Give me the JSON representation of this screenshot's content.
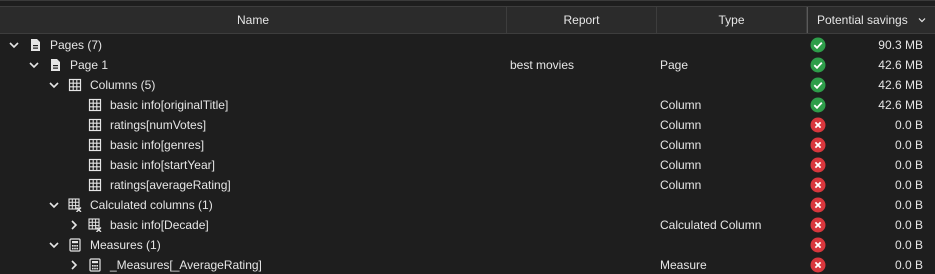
{
  "columns": {
    "name": "Name",
    "report": "Report",
    "type": "Type",
    "savings": "Potential savings"
  },
  "colors": {
    "ok": "#2e9e4a",
    "error": "#d9373d"
  },
  "rows": [
    {
      "depth": 0,
      "chevron": "chevron-down-icon",
      "icon": "page-icon",
      "label": "Pages (7)",
      "report": "",
      "type": "",
      "status": "ok",
      "savings": "90.3 MB"
    },
    {
      "depth": 1,
      "chevron": "chevron-down-icon",
      "icon": "page-icon",
      "label": "Page 1",
      "report": "best movies",
      "type": "Page",
      "status": "ok",
      "savings": "42.6 MB"
    },
    {
      "depth": 2,
      "chevron": "chevron-down-icon",
      "icon": "table-icon",
      "label": "Columns (5)",
      "report": "",
      "type": "",
      "status": "ok",
      "savings": "42.6 MB"
    },
    {
      "depth": 3,
      "chevron": "",
      "icon": "table-icon",
      "label": "basic info[originalTitle]",
      "report": "",
      "type": "Column",
      "status": "ok",
      "savings": "42.6 MB"
    },
    {
      "depth": 3,
      "chevron": "",
      "icon": "table-icon",
      "label": "ratings[numVotes]",
      "report": "",
      "type": "Column",
      "status": "error",
      "savings": "0.0 B"
    },
    {
      "depth": 3,
      "chevron": "",
      "icon": "table-icon",
      "label": "basic info[genres]",
      "report": "",
      "type": "Column",
      "status": "error",
      "savings": "0.0 B"
    },
    {
      "depth": 3,
      "chevron": "",
      "icon": "table-icon",
      "label": "basic info[startYear]",
      "report": "",
      "type": "Column",
      "status": "error",
      "savings": "0.0 B"
    },
    {
      "depth": 3,
      "chevron": "",
      "icon": "table-icon",
      "label": "ratings[averageRating]",
      "report": "",
      "type": "Column",
      "status": "error",
      "savings": "0.0 B"
    },
    {
      "depth": 2,
      "chevron": "chevron-down-icon",
      "icon": "calculated-column-icon",
      "label": "Calculated columns (1)",
      "report": "",
      "type": "",
      "status": "error",
      "savings": "0.0 B"
    },
    {
      "depth": 3,
      "chevron": "chevron-right-icon",
      "icon": "calculated-column-icon",
      "label": "basic info[Decade]",
      "report": "",
      "type": "Calculated Column",
      "status": "error",
      "savings": "0.0 B"
    },
    {
      "depth": 2,
      "chevron": "chevron-down-icon",
      "icon": "calculator-icon",
      "label": "Measures (1)",
      "report": "",
      "type": "",
      "status": "error",
      "savings": "0.0 B"
    },
    {
      "depth": 3,
      "chevron": "chevron-right-icon",
      "icon": "calculator-icon",
      "label": "_Measures[_AverageRating]",
      "report": "",
      "type": "Measure",
      "status": "error",
      "savings": "0.0 B"
    }
  ]
}
